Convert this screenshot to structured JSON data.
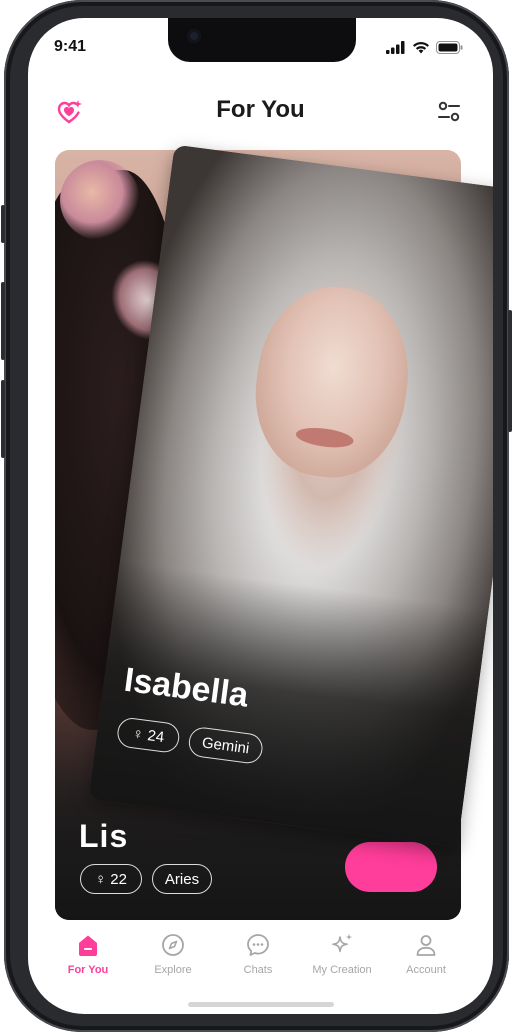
{
  "status_bar": {
    "time": "9:41"
  },
  "header": {
    "title": "For You",
    "logo_icon": "heart-sparkle-icon",
    "filter_icon": "sliders-icon"
  },
  "cards": {
    "front": {
      "name": "Isabella",
      "age": "24",
      "zodiac": "Gemini",
      "gender_icon": "female-icon"
    },
    "back": {
      "name_peek": "Lis",
      "age": "22",
      "zodiac": "Aries",
      "gender_icon": "female-icon"
    }
  },
  "tabbar": {
    "tabs": [
      {
        "label": "For You",
        "icon": "home-icon",
        "active": true
      },
      {
        "label": "Explore",
        "icon": "compass-icon",
        "active": false
      },
      {
        "label": "Chats",
        "icon": "chat-icon",
        "active": false
      },
      {
        "label": "My Creation",
        "icon": "sparkle-icon",
        "active": false
      },
      {
        "label": "Account",
        "icon": "user-icon",
        "active": false
      }
    ]
  },
  "colors": {
    "accent": "#ff3d9a",
    "inactive": "#a6a6a6",
    "text_dark": "#1b1b1b"
  }
}
